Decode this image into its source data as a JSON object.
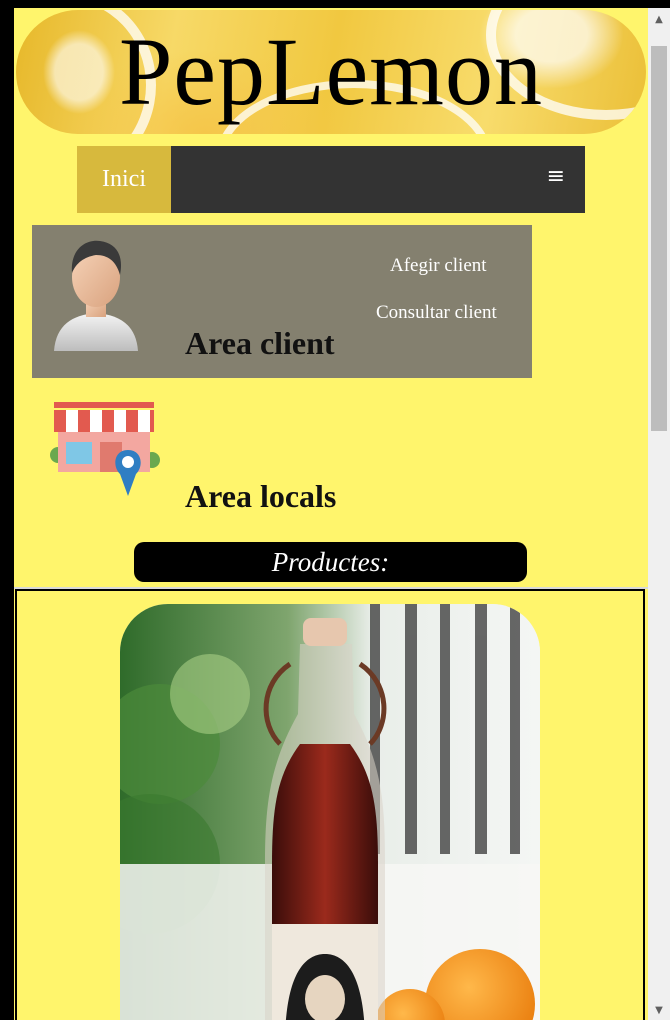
{
  "header": {
    "logo": "PepLemon"
  },
  "nav": {
    "home_label": "Inici",
    "menu_icon": "hamburger-icon",
    "menu_glyph": "≡"
  },
  "client_area": {
    "title": "Area client",
    "links": [
      "Afegir client",
      "Consultar client"
    ],
    "icon": "user-avatar-icon"
  },
  "locals_area": {
    "title": "Area locals",
    "icon": "store-location-icon"
  },
  "products": {
    "heading": "Productes:"
  },
  "scrollbar": {
    "up_glyph": "▲",
    "down_glyph": "▼"
  },
  "colors": {
    "page_background": "#fff56c",
    "nav_background": "#333333",
    "nav_active": "#d7b93d",
    "client_box": "#84806f",
    "products_bar": "#000000"
  }
}
